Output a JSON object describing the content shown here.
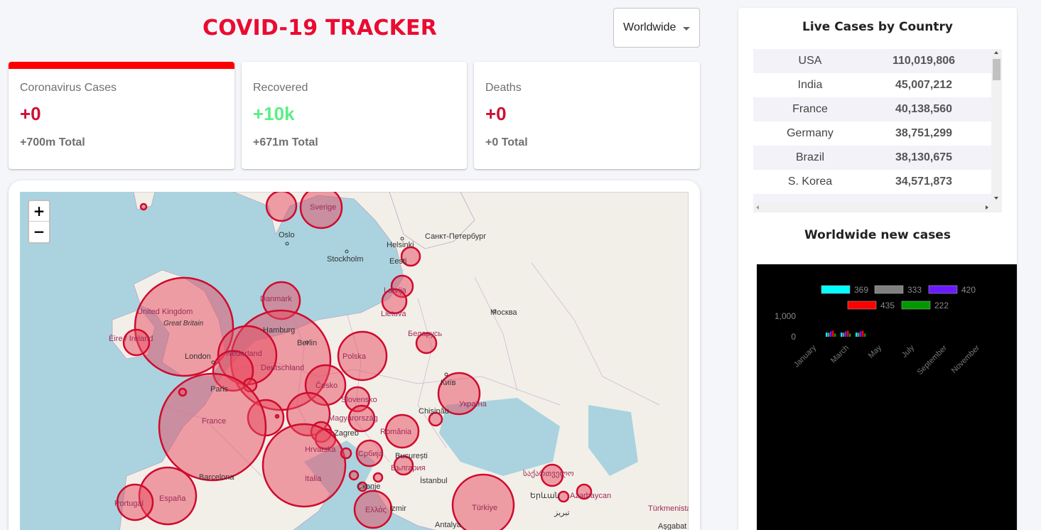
{
  "header": {
    "title": "COVID-19 TRACKER",
    "country_select": "Worldwide"
  },
  "stats": {
    "cases": {
      "label": "Coronavirus Cases",
      "value": "+0",
      "total": "+700m Total"
    },
    "recovered": {
      "label": "Recovered",
      "value": "+10k",
      "total": "+671m Total"
    },
    "deaths": {
      "label": "Deaths",
      "value": "+0",
      "total": "+0 Total"
    }
  },
  "map": {
    "zoom_in": "+",
    "zoom_out": "−",
    "labels": [
      "Sverige",
      "Oslo",
      "Stockholm",
      "Helsinki",
      "Санкт-Петербург",
      "Eesti",
      "Latvija",
      "Lietuva",
      "Москва",
      "Danmark",
      "United Kingdom",
      "Great Britain",
      "Éire / Ireland",
      "London",
      "Hamburg",
      "Nederland",
      "Berlin",
      "Polska",
      "Беларусь",
      "Deutschland",
      "Česko",
      "Київ",
      "Україна",
      "Slovensko",
      "Paris",
      "France",
      "Magyarország",
      "Chișinău",
      "Zagreb",
      "România",
      "Hrvatska",
      "Србија",
      "București",
      "България",
      "Barcelona",
      "Italia",
      "Скопје",
      "İstanbul",
      "España",
      "Portugal",
      "Ελλάς",
      "İzmir",
      "Türkiye",
      "Antalya",
      "საქართველო",
      "Երևան",
      "Azərbaycan",
      "Türkmenistan",
      "Aşgabat",
      "تبریز"
    ],
    "colors": {
      "water": "#aad3df",
      "land": "#f2efe9",
      "bubble_fill": "#e8495f",
      "bubble_stroke": "#d00a2c"
    }
  },
  "live_cases": {
    "title": "Live Cases by Country",
    "rows": [
      {
        "country": "USA",
        "cases": "110,019,806"
      },
      {
        "country": "India",
        "cases": "45,007,212"
      },
      {
        "country": "France",
        "cases": "40,138,560"
      },
      {
        "country": "Germany",
        "cases": "38,751,299"
      },
      {
        "country": "Brazil",
        "cases": "38,130,675"
      },
      {
        "country": "S. Korea",
        "cases": "34,571,873"
      }
    ]
  },
  "new_cases": {
    "title": "Worldwide new cases"
  },
  "chart_data": {
    "type": "bar",
    "categories": [
      "January",
      "March",
      "May",
      "July",
      "September",
      "November"
    ],
    "series": [
      {
        "name": "369",
        "color": "#00ffff",
        "values": [
          369
        ]
      },
      {
        "name": "333",
        "color": "#808080",
        "values": [
          333
        ]
      },
      {
        "name": "420",
        "color": "#6a1aff",
        "values": [
          420
        ]
      },
      {
        "name": "435",
        "color": "#ff0000",
        "values": [
          435
        ]
      },
      {
        "name": "222",
        "color": "#009900",
        "values": [
          222
        ]
      }
    ],
    "y_ticks": [
      "1,000",
      "0"
    ],
    "ylim": [
      0,
      1000
    ],
    "background": "#000000",
    "legend_placement": "top"
  }
}
